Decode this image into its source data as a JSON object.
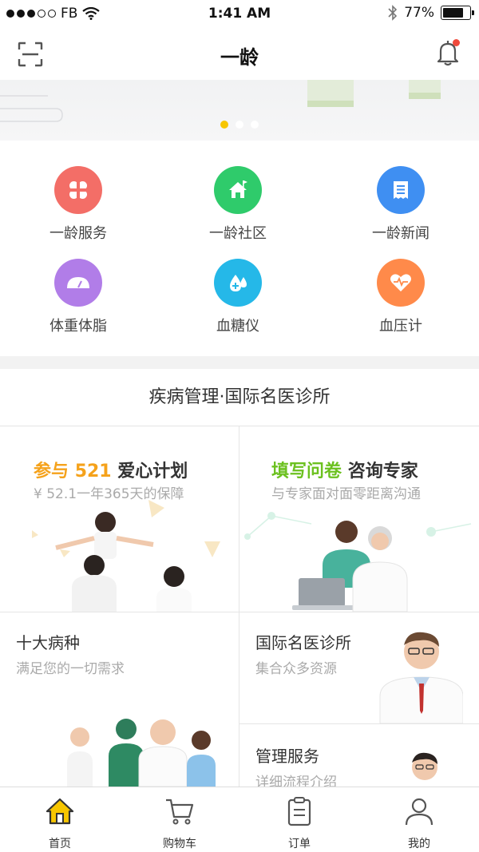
{
  "status_bar": {
    "carrier": "FB",
    "time": "1:41 AM",
    "battery": "77%",
    "battery_level": 0.77
  },
  "nav": {
    "title": "一龄"
  },
  "banner": {
    "dots": 3,
    "active_index": 0
  },
  "grid": {
    "items": [
      {
        "label": "一龄服务",
        "color": "#f36e67",
        "icon": "clover-icon"
      },
      {
        "label": "一龄社区",
        "color": "#2fcb6b",
        "icon": "house-flag-icon"
      },
      {
        "label": "一龄新闻",
        "color": "#3f8ff2",
        "icon": "newspaper-icon"
      },
      {
        "label": "体重体脂",
        "color": "#b17de8",
        "icon": "scale-gauge-icon"
      },
      {
        "label": "血糖仪",
        "color": "#25b8e8",
        "icon": "blood-drop-icon"
      },
      {
        "label": "血压计",
        "color": "#ff8a4a",
        "icon": "heart-pulse-icon"
      }
    ]
  },
  "section": {
    "title": "疾病管理·国际名医诊所"
  },
  "cards": {
    "plan": {
      "title_a": "参与",
      "title_num": "521",
      "title_b": "爱心计划",
      "subtitle": "¥ 52.1一年365天的保障",
      "accent": "#f5a21b"
    },
    "survey": {
      "title_a": "填写问卷",
      "title_b": "咨询专家",
      "subtitle": "与专家面对面零距离沟通",
      "accent": "#6cc120"
    },
    "diseases": {
      "title": "十大病种",
      "subtitle": "满足您的一切需求"
    },
    "clinic": {
      "title": "国际名医诊所",
      "subtitle": "集合众多资源"
    },
    "management": {
      "title": "管理服务",
      "subtitle": "详细流程介绍"
    }
  },
  "tabs": [
    {
      "label": "首页",
      "icon": "home-icon",
      "active": true
    },
    {
      "label": "购物车",
      "icon": "cart-icon",
      "active": false
    },
    {
      "label": "订单",
      "icon": "clipboard-icon",
      "active": false
    },
    {
      "label": "我的",
      "icon": "person-icon",
      "active": false
    }
  ],
  "colors": {
    "accent_yellow": "#f7c600",
    "badge_red": "#f04a3c"
  }
}
